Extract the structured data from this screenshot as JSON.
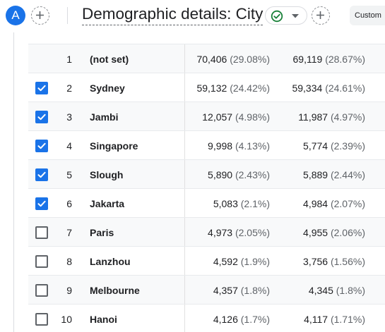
{
  "header": {
    "avatar_letter": "A",
    "title": "Demographic details: City",
    "custom_chip_label": "Custom"
  },
  "icons": {
    "add": "plus-circle-dashed",
    "status": "check-circle-green",
    "caret": "caret-down"
  },
  "colors": {
    "accent": "#1a73e8",
    "status_green": "#188038"
  },
  "table": {
    "rows": [
      {
        "checkbox": null,
        "rank": "1",
        "city": "(not set)",
        "v1": "70,406",
        "p1": "(29.08%)",
        "v2": "69,119",
        "p2": "(28.67%)"
      },
      {
        "checkbox": true,
        "rank": "2",
        "city": "Sydney",
        "v1": "59,132",
        "p1": "(24.42%)",
        "v2": "59,334",
        "p2": "(24.61%)"
      },
      {
        "checkbox": true,
        "rank": "3",
        "city": "Jambi",
        "v1": "12,057",
        "p1": "(4.98%)",
        "v2": "11,987",
        "p2": "(4.97%)"
      },
      {
        "checkbox": true,
        "rank": "4",
        "city": "Singapore",
        "v1": "9,998",
        "p1": "(4.13%)",
        "v2": "5,774",
        "p2": "(2.39%)"
      },
      {
        "checkbox": true,
        "rank": "5",
        "city": "Slough",
        "v1": "5,890",
        "p1": "(2.43%)",
        "v2": "5,889",
        "p2": "(2.44%)"
      },
      {
        "checkbox": true,
        "rank": "6",
        "city": "Jakarta",
        "v1": "5,083",
        "p1": "(2.1%)",
        "v2": "4,984",
        "p2": "(2.07%)"
      },
      {
        "checkbox": false,
        "rank": "7",
        "city": "Paris",
        "v1": "4,973",
        "p1": "(2.05%)",
        "v2": "4,955",
        "p2": "(2.06%)"
      },
      {
        "checkbox": false,
        "rank": "8",
        "city": "Lanzhou",
        "v1": "4,592",
        "p1": "(1.9%)",
        "v2": "3,756",
        "p2": "(1.56%)"
      },
      {
        "checkbox": false,
        "rank": "9",
        "city": "Melbourne",
        "v1": "4,357",
        "p1": "(1.8%)",
        "v2": "4,345",
        "p2": "(1.8%)"
      },
      {
        "checkbox": false,
        "rank": "10",
        "city": "Hanoi",
        "v1": "4,126",
        "p1": "(1.7%)",
        "v2": "4,117",
        "p2": "(1.71%)"
      }
    ]
  }
}
